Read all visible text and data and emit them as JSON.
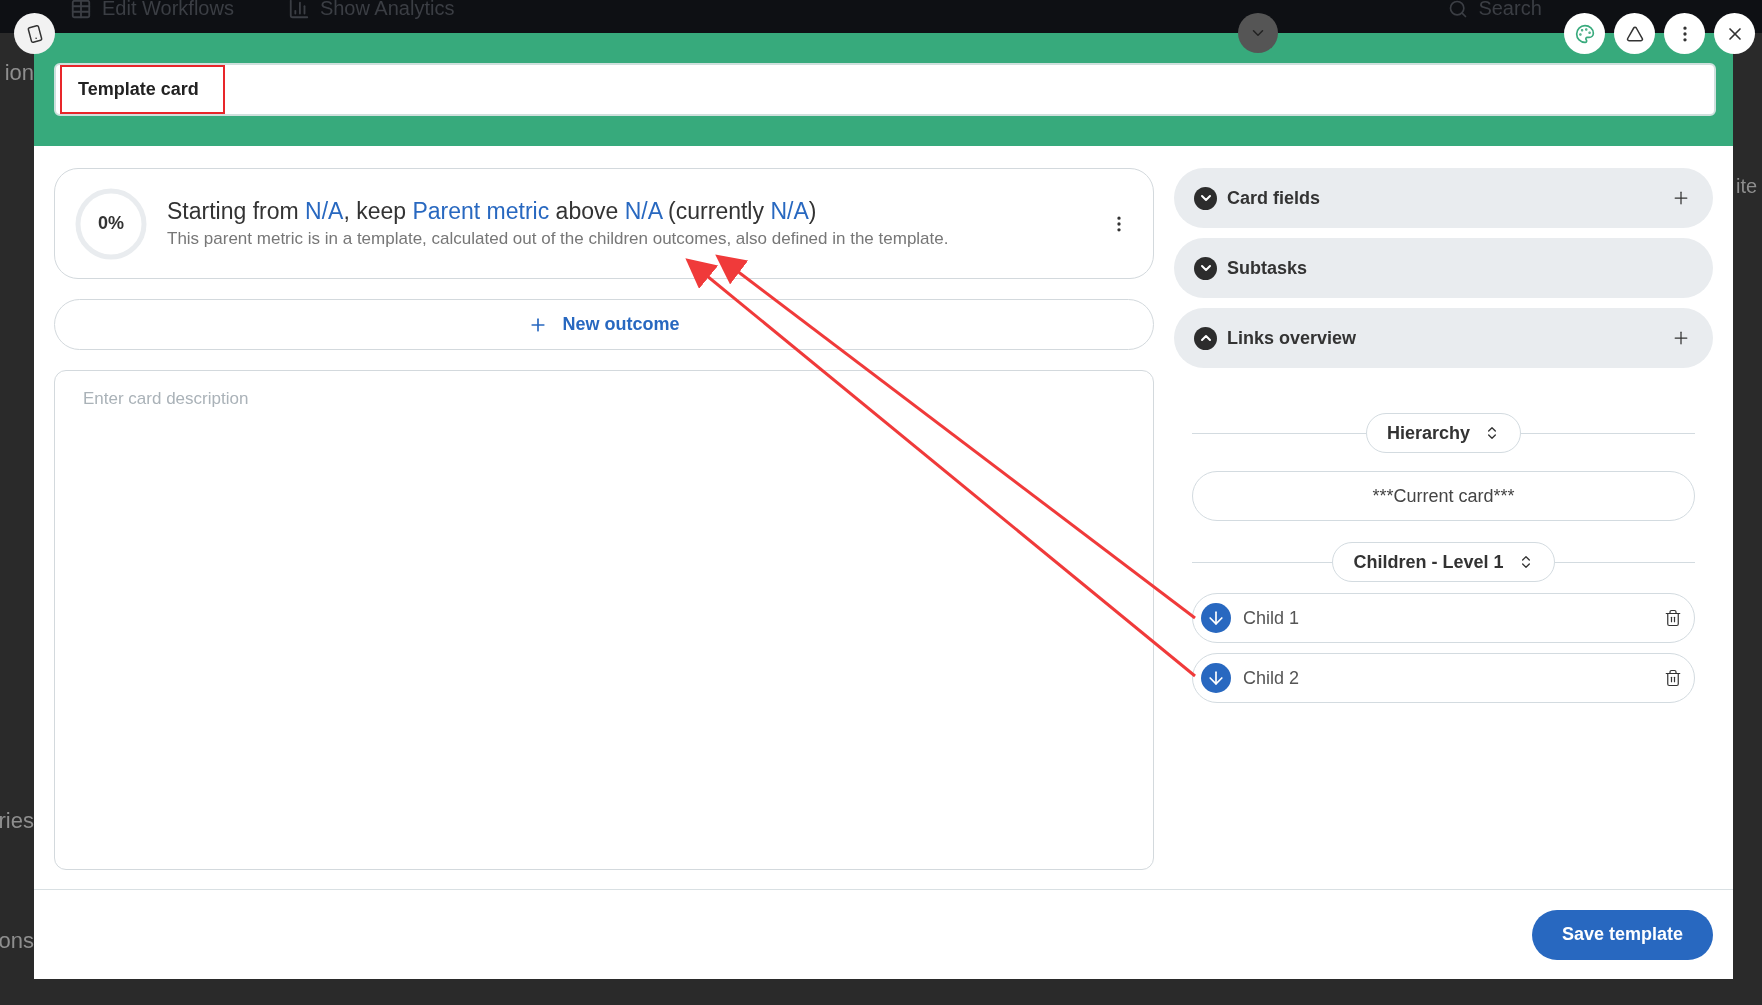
{
  "background_app": {
    "toolbar": [
      "Edit Workflows",
      "Show Analytics",
      "Search"
    ],
    "left_fragments": [
      "ion",
      "ries",
      "ons"
    ],
    "right_fragment": "ite"
  },
  "modal": {
    "title": "Template card",
    "metric": {
      "progress": "0%",
      "level": 0,
      "headline": [
        {
          "kind": "plain",
          "text": "Starting from "
        },
        {
          "kind": "value",
          "text": "N/A"
        },
        {
          "kind": "plain",
          "text": ", keep "
        },
        {
          "kind": "value",
          "text": "Parent metric"
        },
        {
          "kind": "plain",
          "text": " above "
        },
        {
          "kind": "value",
          "text": "N/A"
        },
        {
          "kind": "plain",
          "text": " (currently "
        },
        {
          "kind": "value",
          "text": "N/A"
        },
        {
          "kind": "plain",
          "text": ")"
        }
      ],
      "description": "This parent metric is in a template, calculated out of the children outcomes, also defined in the template."
    },
    "new_outcome": "New outcome",
    "description_field": {
      "placeholder": "Enter card description"
    },
    "sections": [
      {
        "title": "Card fields",
        "expanded": false,
        "addable": true
      },
      {
        "title": "Subtasks",
        "expanded": false,
        "addable": false
      },
      {
        "title": "Links overview",
        "expanded": true,
        "addable": true
      }
    ],
    "hierarchy": {
      "label": "Hierarchy",
      "current_card": "***Current card***",
      "group": "Children - Level 1",
      "children": [
        {
          "name": "Child 1"
        },
        {
          "name": "Child 2"
        }
      ]
    },
    "save_button": "Save template"
  }
}
